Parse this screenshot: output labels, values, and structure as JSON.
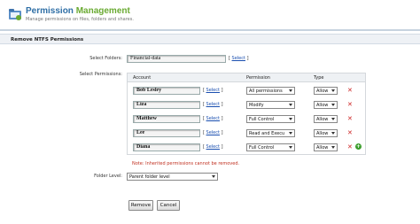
{
  "header": {
    "title_part1": "Permission",
    "title_part2": "Management",
    "subtitle": "Manage permissions on files, folders and shares."
  },
  "section": {
    "title": "Remove NTFS Permissions"
  },
  "folders": {
    "label": "Select Folders:",
    "value": "Financial-data",
    "select_link": "Select"
  },
  "permissions": {
    "label": "Select Permissions:",
    "columns": [
      "Account",
      "Permission",
      "Type"
    ],
    "rows": [
      {
        "account": "Bob Lesley",
        "select": "Select",
        "permission": "All permissions",
        "type": "Allow"
      },
      {
        "account": "Liza",
        "select": "Select",
        "permission": "Modify",
        "type": "Allow"
      },
      {
        "account": "Matthew",
        "select": "Select",
        "permission": "Full Control",
        "type": "Allow"
      },
      {
        "account": "Lee",
        "select": "Select",
        "permission": "Read and Execu",
        "type": "Allow"
      },
      {
        "account": "Diana",
        "select": "Select",
        "permission": "Full Control",
        "type": "Allow"
      }
    ],
    "note": "Note: Inherited permissions cannot be removed."
  },
  "folder_level": {
    "label": "Folder Level:",
    "value": "Parent folder level"
  },
  "buttons": {
    "remove": "Remove",
    "cancel": "Cancel"
  },
  "icons": {
    "delete": "delete-x-icon",
    "add": "add-plus-icon",
    "logo": "folder-permission-icon"
  },
  "colors": {
    "title_blue": "#2f6fa6",
    "title_green": "#6aaa32",
    "delete_red": "#cc2222",
    "add_green": "#3a9d2a",
    "note_red": "#c03020"
  }
}
